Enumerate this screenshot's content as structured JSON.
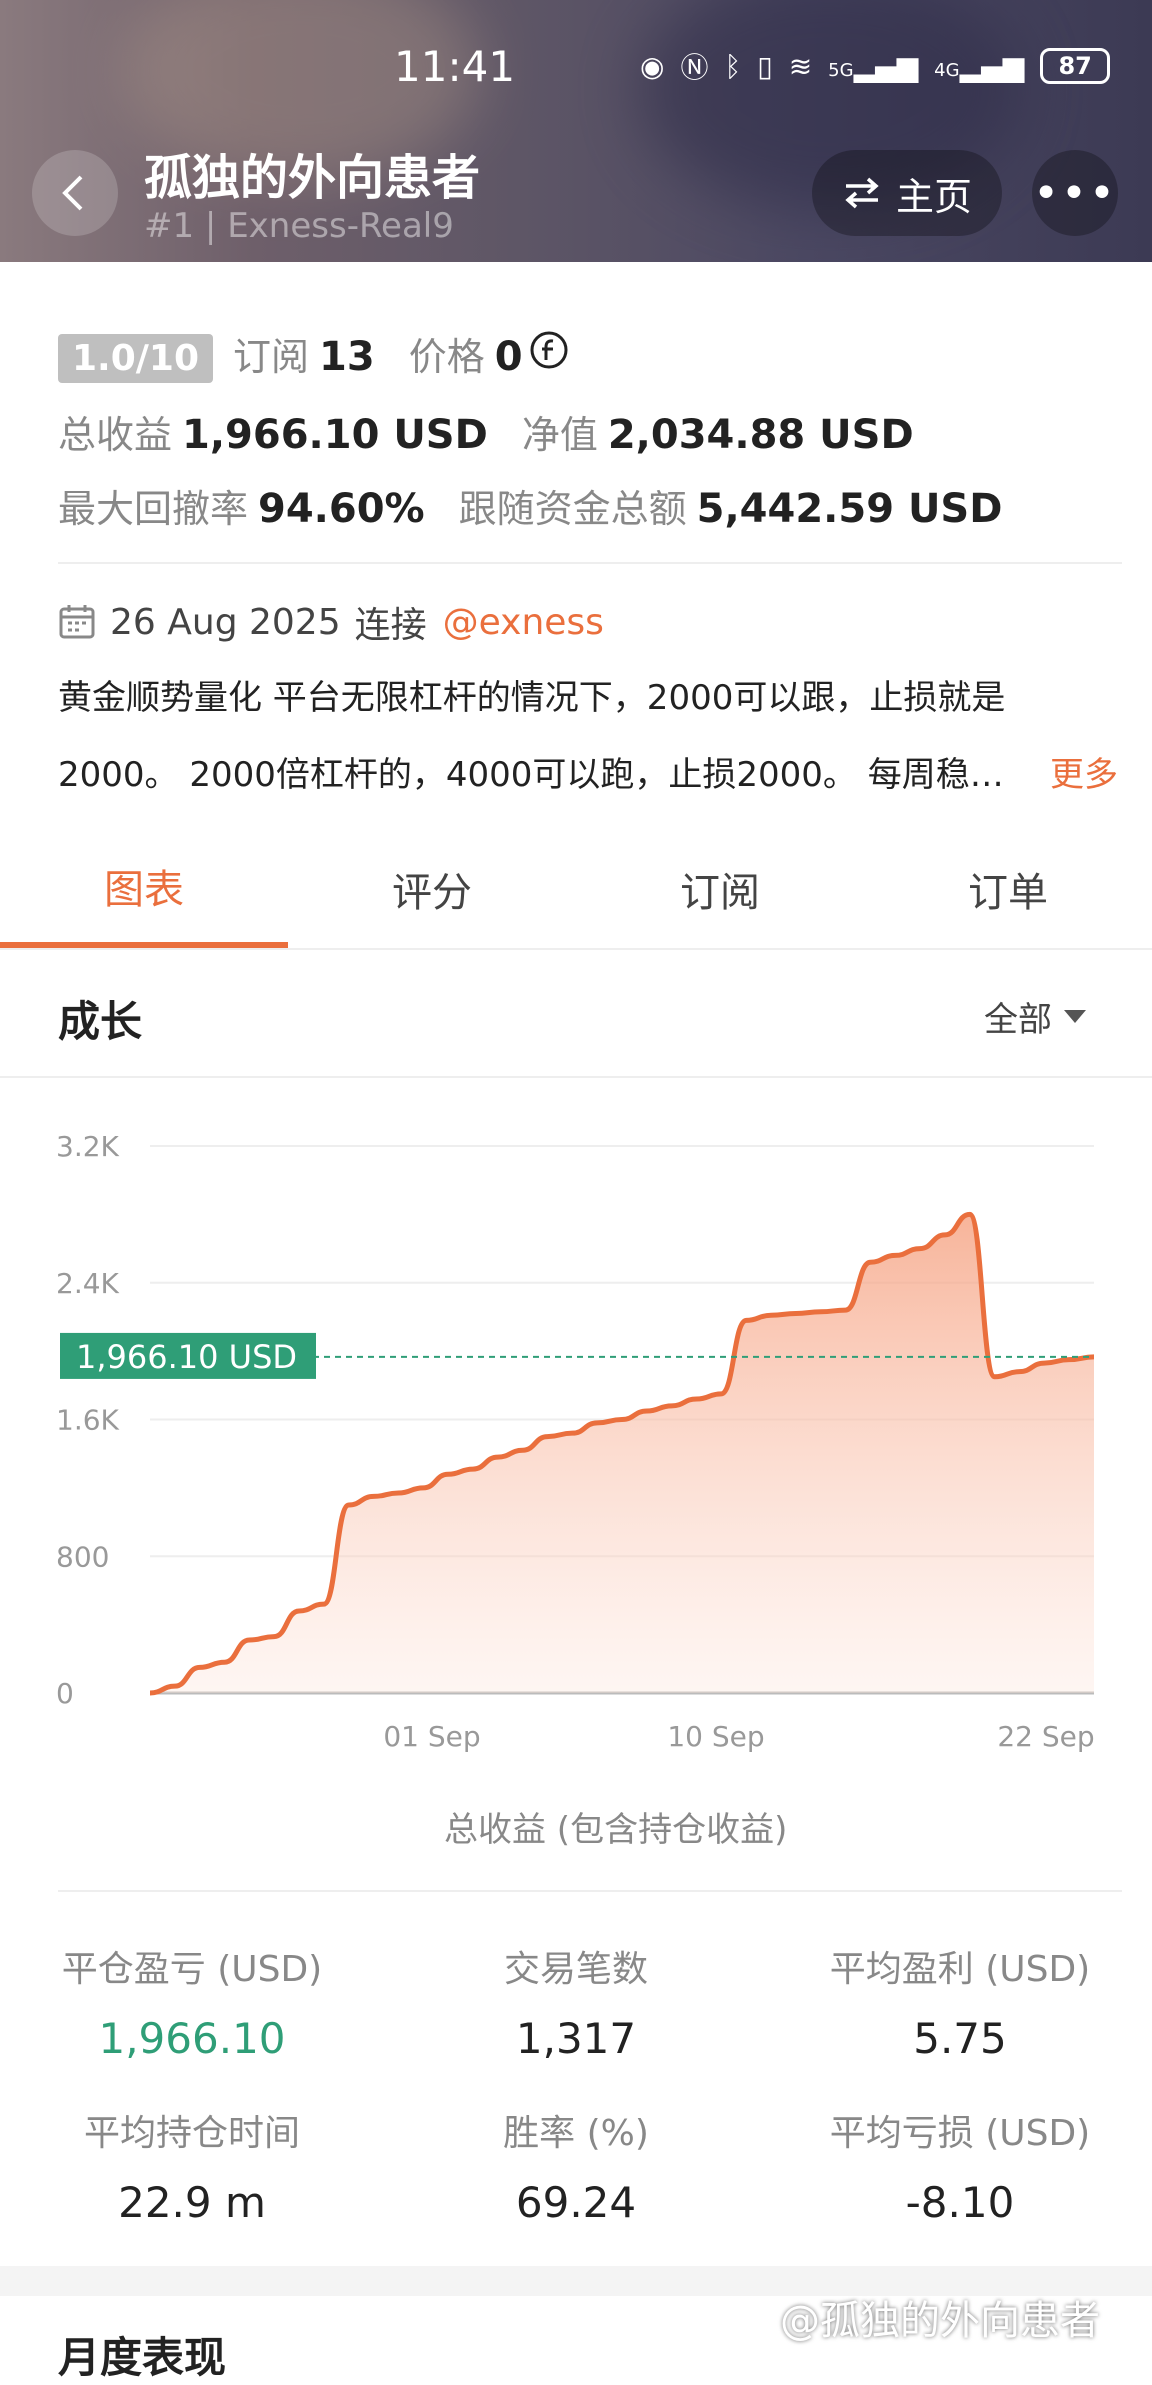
{
  "status_bar": {
    "time": "11:41",
    "battery": "87",
    "net1": "5G",
    "net2": "4G"
  },
  "header": {
    "title": "孤独的外向患者",
    "subtitle": "#1 | Exness-Real9",
    "home_label": "主页",
    "more_label": "•••"
  },
  "summary": {
    "rating": "1.0/10",
    "subscribe_label": "订阅",
    "subscribe_value": "13",
    "price_label": "价格",
    "price_value": "0",
    "total_profit_label": "总收益",
    "total_profit_value": "1,966.10 USD",
    "equity_label": "净值",
    "equity_value": "2,034.88 USD",
    "max_drawdown_label": "最大回撤率",
    "max_drawdown_value": "94.60%",
    "follow_funds_label": "跟随资金总额",
    "follow_funds_value": "5,442.59 USD"
  },
  "info": {
    "date": "26 Aug 2025",
    "connect_label": "连接",
    "broker": "@exness",
    "description_line1": "黄金顺势量化 平台无限杠杆的情况下，2000可以跟，止损就是",
    "description_line2": "2000。 2000倍杠杆的，4000可以跑，止损2000。 每周稳…",
    "more_link": "更多"
  },
  "tabs": [
    {
      "label": "图表"
    },
    {
      "label": "评分"
    },
    {
      "label": "订阅"
    },
    {
      "label": "订单"
    }
  ],
  "growth": {
    "title": "成长",
    "filter": "全部"
  },
  "chart_data": {
    "type": "area",
    "y_ticks": [
      "3.2K",
      "2.4K",
      "1.6K",
      "800",
      "0"
    ],
    "x_ticks": [
      "01 Sep",
      "10 Sep",
      "22 Sep"
    ],
    "ylim": [
      0,
      3200
    ],
    "current_label": "1,966.10 USD",
    "current_value": 1966.1,
    "legend": "总收益 (包含持仓收益)",
    "color": "#ea6f3d",
    "series": [
      {
        "values": [
          0,
          40,
          150,
          180,
          310,
          330,
          480,
          520,
          1100,
          1150,
          1170,
          1200,
          1280,
          1310,
          1380,
          1420,
          1500,
          1520,
          1580,
          1600,
          1650,
          1680,
          1720,
          1750,
          2180,
          2210,
          2220,
          2230,
          2240,
          2520,
          2560,
          2600,
          2680,
          2800,
          1850,
          1880,
          1930,
          1950,
          1966.1
        ]
      }
    ]
  },
  "stats": [
    {
      "label": "平仓盈亏 (USD)",
      "value": "1,966.10"
    },
    {
      "label": "交易笔数",
      "value": "1,317"
    },
    {
      "label": "平均盈利 (USD)",
      "value": "5.75"
    },
    {
      "label": "平均持仓时间",
      "value": "22.9 m"
    },
    {
      "label": "胜率 (%)",
      "value": "69.24"
    },
    {
      "label": "平均亏损 (USD)",
      "value": "-8.10"
    }
  ],
  "monthly": {
    "title": "月度表现"
  },
  "watermark": "@孤独的外向患者",
  "colors": {
    "accent": "#ea6f3d",
    "positive": "#2f9e77"
  }
}
